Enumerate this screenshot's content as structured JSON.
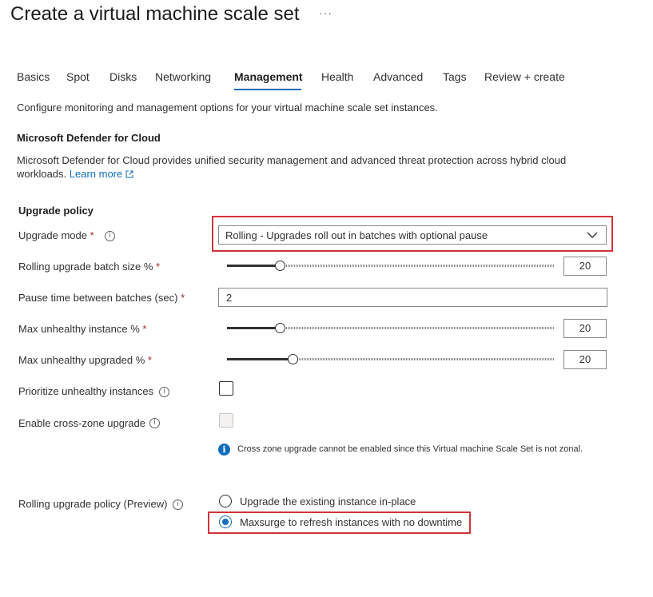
{
  "page": {
    "title": "Create a virtual machine scale set",
    "more_label": "···"
  },
  "tabs": [
    {
      "label": "Basics",
      "active": false
    },
    {
      "label": "Spot",
      "active": false
    },
    {
      "label": "Disks",
      "active": false
    },
    {
      "label": "Networking",
      "active": false
    },
    {
      "label": "Management",
      "active": true
    },
    {
      "label": "Health",
      "active": false
    },
    {
      "label": "Advanced",
      "active": false
    },
    {
      "label": "Tags",
      "active": false
    },
    {
      "label": "Review + create",
      "active": false
    }
  ],
  "intro": "Configure monitoring and management options for your virtual machine scale set instances.",
  "defender": {
    "heading": "Microsoft Defender for Cloud",
    "description_line1": "Microsoft Defender for Cloud provides unified security management and advanced threat protection across hybrid cloud",
    "description_line2": "workloads.",
    "learn_more": "Learn more"
  },
  "upgrade": {
    "heading": "Upgrade policy",
    "required_mark": "*",
    "mode_label": "Upgrade mode",
    "mode_value": "Rolling - Upgrades roll out in batches with optional pause",
    "batch_label": "Rolling upgrade batch size %",
    "batch_value": "20",
    "batch_fraction": 0.16,
    "pause_label": "Pause time between batches (sec)",
    "pause_value": "2",
    "unhealthy_label": "Max unhealthy instance %",
    "unhealthy_value": "20",
    "unhealthy_fraction": 0.16,
    "upgraded_label": "Max unhealthy upgraded %",
    "upgraded_value": "20",
    "upgraded_fraction": 0.2,
    "prioritize_label": "Prioritize unhealthy instances",
    "crosszone_label": "Enable cross-zone upgrade",
    "crosszone_note": "Cross zone upgrade cannot be enabled since this Virtual machine Scale Set is not zonal.",
    "policy_label": "Rolling upgrade policy (Preview)",
    "policy_options": [
      {
        "label": "Upgrade the existing instance in-place",
        "selected": false
      },
      {
        "label": "Maxsurge to refresh instances with no downtime",
        "selected": true
      }
    ]
  },
  "colors": {
    "accent": "#0f6cbd",
    "highlight": "#d13438",
    "required": "#a4262c"
  }
}
